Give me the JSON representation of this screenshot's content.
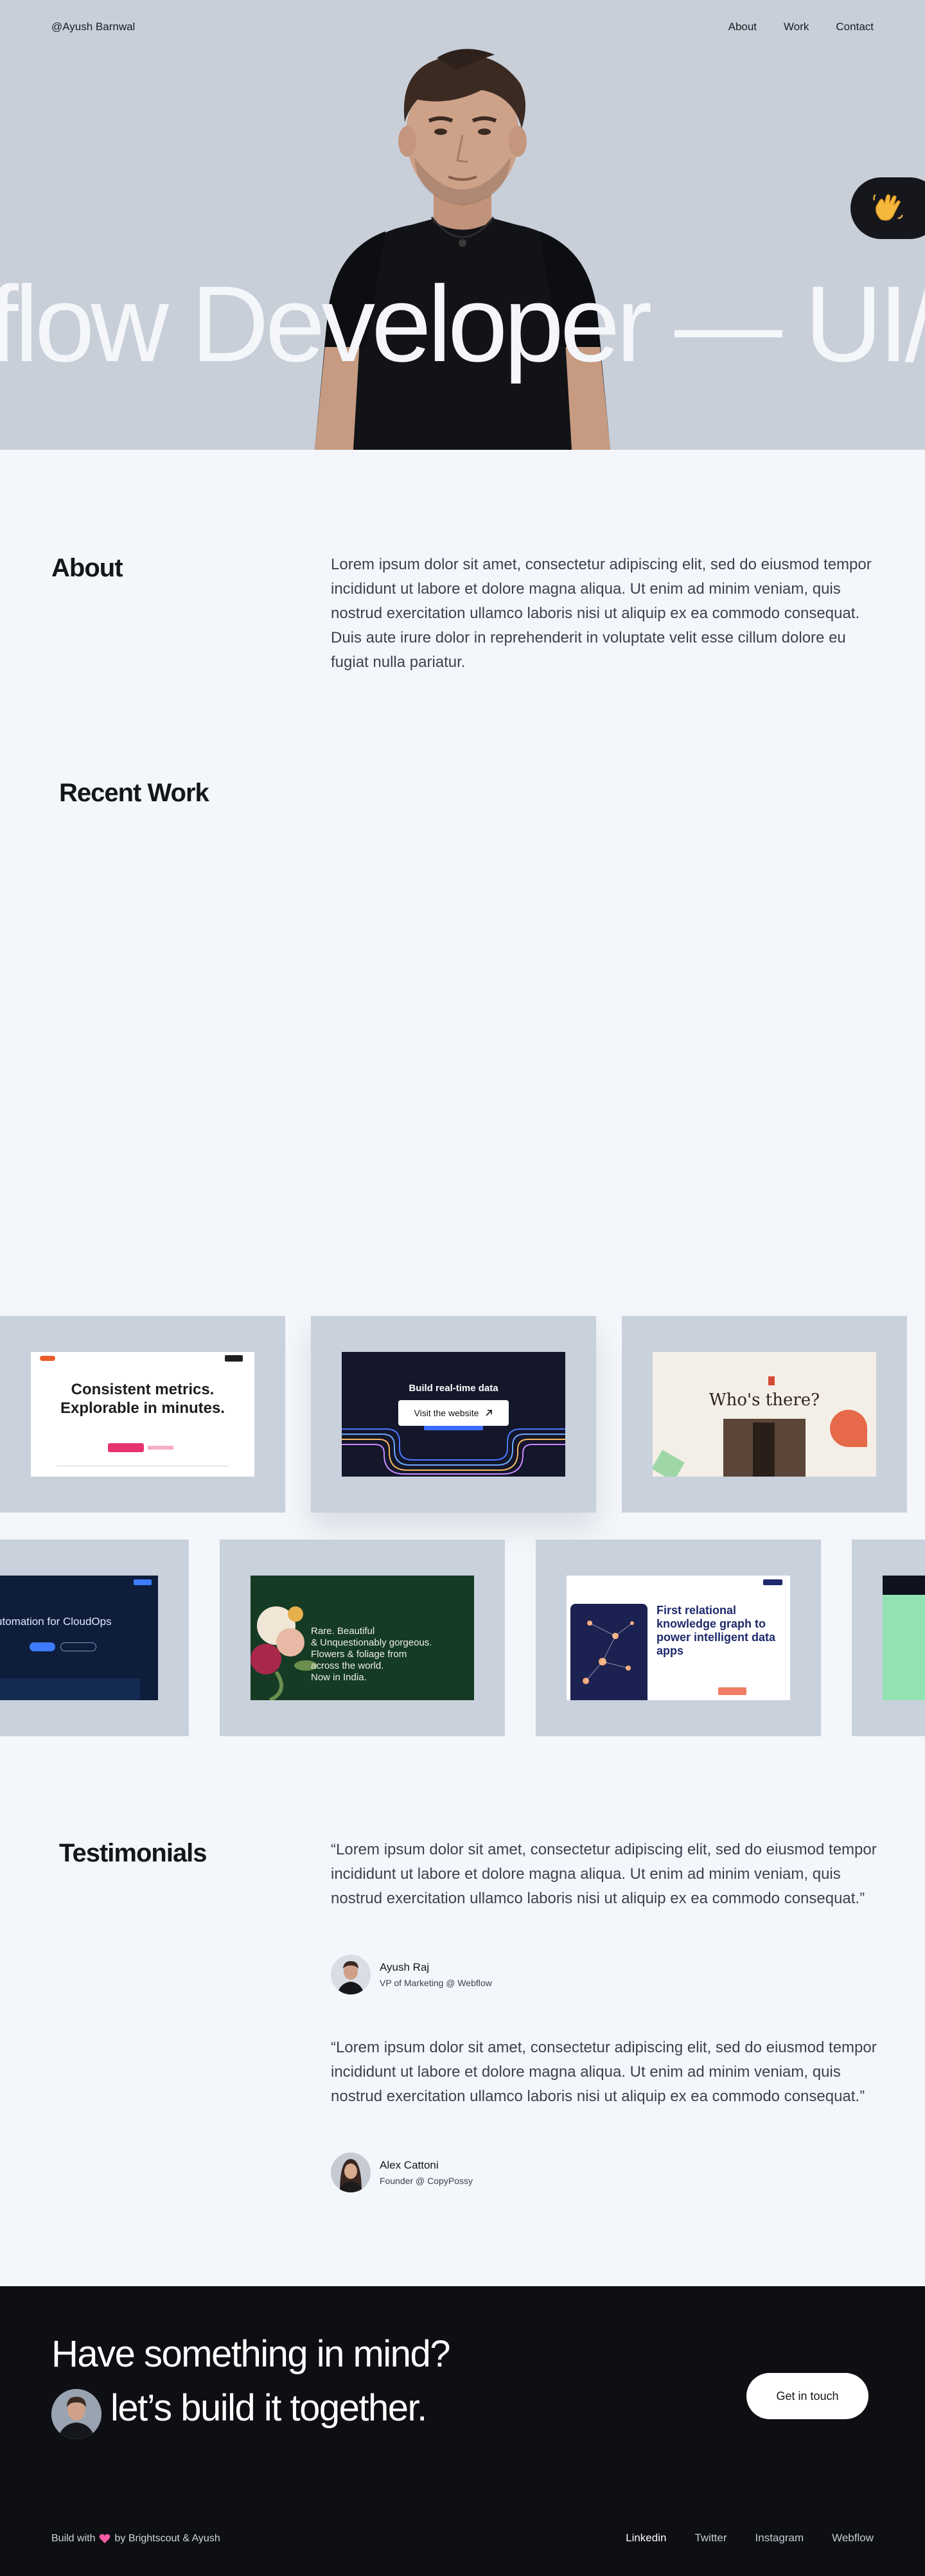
{
  "nav": {
    "brand": "@Ayush Barnwal",
    "links": [
      "About",
      "Work",
      "Contact"
    ]
  },
  "hero": {
    "title": "flow Developer — UI/U",
    "wave_icon": "waving-hand-icon"
  },
  "about": {
    "heading": "About",
    "body": "Lorem ipsum dolor sit amet, consectetur adipiscing elit, sed do eiusmod tempor incididunt ut labore et dolore magna aliqua. Ut enim ad minim veniam, quis nostrud exercitation ullamco laboris nisi ut aliquip ex ea commodo consequat. Duis aute irure dolor in reprehenderit in voluptate velit esse cillum dolore eu fugiat nulla pariatur."
  },
  "work": {
    "heading": "Recent Work",
    "row1": [
      {
        "headline_1": "Consistent metrics.",
        "headline_2": "Explorable in minutes."
      },
      {
        "headline": "Build real-time data",
        "button": "Visit the website"
      },
      {
        "headline": "Who's there?"
      }
    ],
    "row2": [
      {
        "headline": "e automation for CloudOps"
      },
      {
        "line1": "Rare. Beautiful",
        "line2": "& Unquestionably gorgeous.",
        "line3": "Flowers & foliage from",
        "line4": "across the world.",
        "line5": "Now in India."
      },
      {
        "headline": "First relational knowledge graph to power intelligent data apps"
      },
      {}
    ]
  },
  "testimonials": {
    "heading": "Testimonials",
    "items": [
      {
        "quote": "“Lorem ipsum dolor sit amet, consectetur adipiscing elit, sed do eiusmod tempor incididunt ut labore et dolore magna aliqua. Ut enim ad minim veniam, quis nostrud exercitation ullamco laboris nisi ut aliquip ex ea commodo consequat.”",
        "name": "Ayush Raj",
        "role": "VP of Marketing @ Webflow"
      },
      {
        "quote": "“Lorem ipsum dolor sit amet, consectetur adipiscing elit, sed do eiusmod tempor incididunt ut labore et dolore magna aliqua. Ut enim ad minim veniam, quis nostrud exercitation ullamco laboris nisi ut aliquip ex ea commodo consequat.”",
        "name": "Alex Cattoni",
        "role": "Founder @ CopyPossy"
      }
    ]
  },
  "footer": {
    "cta_line_1": "Have something in mind?",
    "cta_line_2": "let’s build it together.",
    "cta_button": "Get in touch",
    "credit_prefix": "Build with",
    "credit_suffix": "by Brightscout & Ayush",
    "links": [
      "Linkedin",
      "Twitter",
      "Instagram",
      "Webflow"
    ],
    "active_link_color": "#ffffff",
    "link_color": "#c6cad2"
  },
  "colors": {
    "hero_bg": "#c8cfd9",
    "page_bg": "#f3f6fa",
    "card_bg": "#c9d1dc",
    "footer_bg": "#0d0f13"
  }
}
